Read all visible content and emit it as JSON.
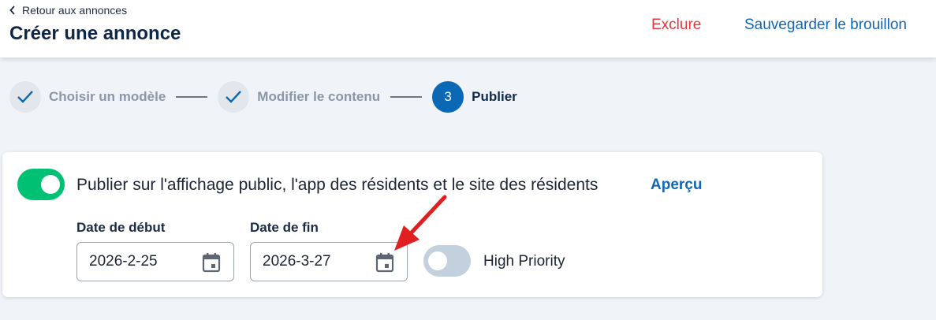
{
  "header": {
    "back_label": "Retour aux annonces",
    "title": "Créer une annonce",
    "exclude_label": "Exclure",
    "save_label": "Sauvegarder le brouillon"
  },
  "stepper": {
    "steps": [
      {
        "label": "Choisir un modèle",
        "state": "done",
        "icon": "check-icon"
      },
      {
        "label": "Modifier le contenu",
        "state": "done",
        "icon": "check-icon"
      },
      {
        "label": "Publier",
        "state": "active",
        "number": "3"
      }
    ]
  },
  "publish_card": {
    "publish_toggle_on": true,
    "publish_label": "Publier sur l'affichage public, l'app des résidents et le site des résidents",
    "preview_label": "Aperçu",
    "start_date": {
      "label": "Date de début",
      "value": "2026-2-25",
      "icon": "calendar-icon"
    },
    "end_date": {
      "label": "Date de fin",
      "value": "2026-3-27",
      "icon": "calendar-icon"
    },
    "priority_toggle_on": false,
    "priority_label": "High Priority"
  },
  "colors": {
    "accent": "#0b68b5",
    "link": "#1366b5",
    "danger": "#e0383b",
    "toggle_on": "#00c173",
    "toggle_off": "#c3d0dd",
    "annotation_arrow": "#e02020"
  }
}
